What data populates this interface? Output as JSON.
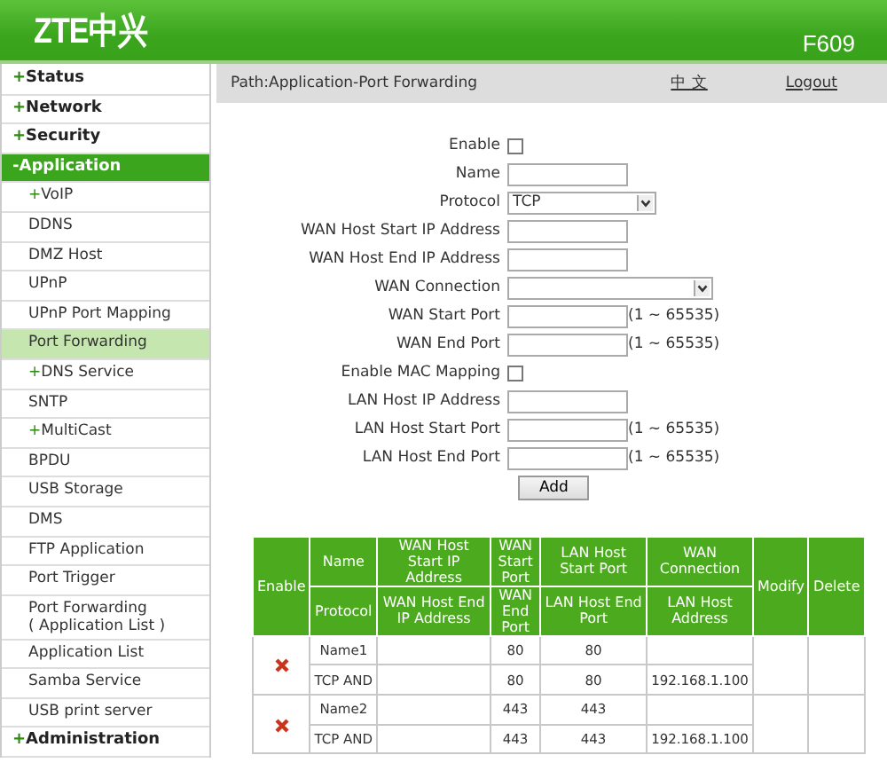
{
  "header": {
    "logo": "ZTE中兴",
    "model": "F609"
  },
  "sidebar": {
    "items": [
      {
        "kind": "section",
        "marker": "+",
        "label": "Status",
        "selected": false
      },
      {
        "kind": "section",
        "marker": "+",
        "label": "Network",
        "selected": false
      },
      {
        "kind": "section",
        "marker": "+",
        "label": "Security",
        "selected": false
      },
      {
        "kind": "section",
        "marker": "-",
        "label": "Application",
        "selected": true
      },
      {
        "kind": "item",
        "marker": "+",
        "label": "VoIP",
        "selected": false
      },
      {
        "kind": "item",
        "label": "DDNS",
        "selected": false
      },
      {
        "kind": "item",
        "label": "DMZ Host",
        "selected": false
      },
      {
        "kind": "item",
        "label": "UPnP",
        "selected": false
      },
      {
        "kind": "item",
        "label": "UPnP Port Mapping",
        "selected": false
      },
      {
        "kind": "item",
        "label": "Port Forwarding",
        "selected": true
      },
      {
        "kind": "item",
        "marker": "+",
        "label": "DNS Service",
        "selected": false
      },
      {
        "kind": "item",
        "label": "SNTP",
        "selected": false
      },
      {
        "kind": "item",
        "marker": "+",
        "label": "MultiCast",
        "selected": false
      },
      {
        "kind": "item",
        "label": "BPDU",
        "selected": false
      },
      {
        "kind": "item",
        "label": "USB Storage",
        "selected": false
      },
      {
        "kind": "item",
        "label": "DMS",
        "selected": false
      },
      {
        "kind": "item",
        "label": "FTP Application",
        "selected": false
      },
      {
        "kind": "item",
        "label": "Port Trigger",
        "selected": false
      },
      {
        "kind": "item",
        "label": "Port Forwarding\n( Application List )",
        "selected": false
      },
      {
        "kind": "item",
        "label": "Application List",
        "selected": false
      },
      {
        "kind": "item",
        "label": "Samba Service",
        "selected": false
      },
      {
        "kind": "item",
        "label": "USB print server",
        "selected": false
      },
      {
        "kind": "section",
        "marker": "+",
        "label": "Administration",
        "selected": false
      }
    ]
  },
  "path_bar": {
    "path": "Path:Application-Port Forwarding",
    "language_link": "中 文",
    "logout_link": "Logout"
  },
  "form": {
    "fields": [
      {
        "kind": "checkbox",
        "label": "Enable",
        "checked": false
      },
      {
        "kind": "text",
        "label": "Name"
      },
      {
        "kind": "select",
        "label": "Protocol",
        "value": "TCP"
      },
      {
        "kind": "text",
        "label": "WAN Host Start IP Address"
      },
      {
        "kind": "text",
        "label": "WAN Host End IP Address"
      },
      {
        "kind": "wideselect",
        "label": "WAN Connection"
      },
      {
        "kind": "text",
        "label": "WAN Start Port",
        "hint": "(1 ~ 65535)"
      },
      {
        "kind": "text",
        "label": "WAN End Port",
        "hint": "(1 ~ 65535)"
      },
      {
        "kind": "checkbox",
        "label": "Enable MAC Mapping",
        "checked": false
      },
      {
        "kind": "text",
        "label": "LAN Host IP Address"
      },
      {
        "kind": "text",
        "label": "LAN Host Start Port",
        "hint": "(1 ~ 65535)"
      },
      {
        "kind": "text",
        "label": "LAN Host End Port",
        "hint": "(1 ~ 65535)"
      }
    ],
    "add_button": "Add"
  },
  "table": {
    "header_top": [
      "Enable",
      "Name",
      "WAN Host Start IP Address",
      "WAN Start Port",
      "LAN Host Start Port",
      "WAN Connection",
      "Modify",
      "Delete"
    ],
    "header_bottom": [
      "Protocol",
      "WAN Host End IP Address",
      "WAN End Port",
      "LAN Host End Port",
      "LAN Host Address"
    ],
    "rules": [
      {
        "enabled": false,
        "name": "Name1",
        "protocol": "TCP AND",
        "wan_start_port": "80",
        "wan_end_port": "80",
        "lan_start_port": "80",
        "lan_end_port": "80",
        "lan_host_address": "192.168.1.100"
      },
      {
        "enabled": false,
        "name": "Name2",
        "protocol": "TCP AND",
        "wan_start_port": "443",
        "wan_end_port": "443",
        "lan_start_port": "443",
        "lan_end_port": "443",
        "lan_host_address": "192.168.1.100"
      }
    ]
  }
}
